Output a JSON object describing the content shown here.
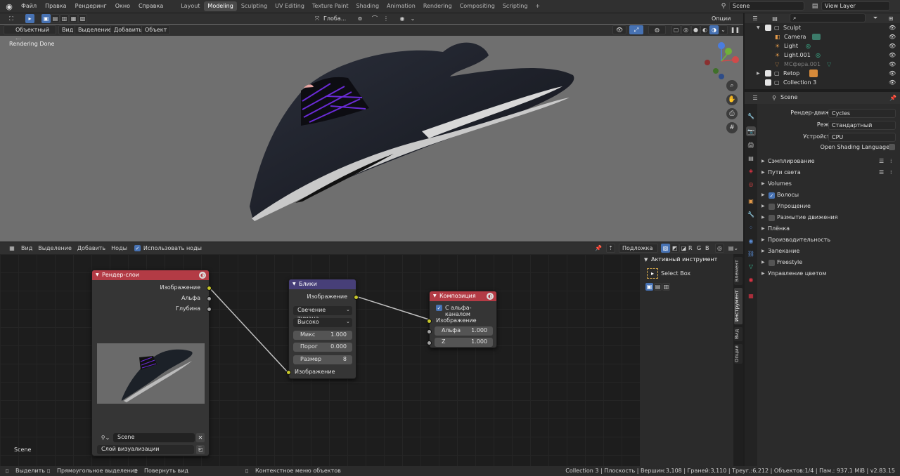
{
  "topbar": {
    "menus": [
      "Файл",
      "Правка",
      "Рендеринг",
      "Окно",
      "Справка"
    ],
    "workspaces": [
      "Layout",
      "Modeling",
      "Sculpting",
      "UV Editing",
      "Texture Paint",
      "Shading",
      "Animation",
      "Rendering",
      "Compositing",
      "Scripting"
    ],
    "active_workspace": "Modeling",
    "scene": "Scene",
    "view_layer": "View Layer",
    "add_tab": "+"
  },
  "viewport": {
    "mode": "Объектный ...",
    "menus": [
      "Вид",
      "Выделение",
      "Добавить",
      "Объект"
    ],
    "orientation": "Глоба...",
    "options": "Опции",
    "status_text": "Rendering Done"
  },
  "node_editor": {
    "menus": [
      "Вид",
      "Выделение",
      "Добавить",
      "Ноды"
    ],
    "use_nodes_label": "Использовать ноды",
    "backdrop_label": "Подложка",
    "channels": [
      "R",
      "G",
      "B"
    ],
    "scene_label": "Scene",
    "render_layers": {
      "title": "Рендер-слои",
      "outputs": [
        "Изображение",
        "Альфа",
        "Глубина"
      ],
      "scene_field": "Scene",
      "layer_field": "Слой визуализации"
    },
    "glare": {
      "title": "Блики",
      "output": "Изображение",
      "type": "Свечение тумана",
      "quality": "Высоко",
      "mix_label": "Микс",
      "mix_value": "1.000",
      "threshold_label": "Порог",
      "threshold_value": "0.000",
      "size_label": "Размер",
      "size_value": "8",
      "input": "Изображение"
    },
    "composite": {
      "title": "Композиция",
      "use_alpha": "С альфа-каналом",
      "image": "Изображение",
      "alpha_label": "Альфа",
      "alpha_value": "1.000",
      "z_label": "Z",
      "z_value": "1.000"
    }
  },
  "npanel": {
    "header": "Активный инструмент",
    "tool": "Select Box",
    "tabs": [
      "Элемент",
      "Инструмент",
      "Вид",
      "Опции"
    ],
    "active_tab": "Инструмент"
  },
  "outliner": {
    "items": [
      {
        "name": "Sculpt",
        "indent": 0,
        "dim": false
      },
      {
        "name": "Camera",
        "indent": 1,
        "dim": false
      },
      {
        "name": "Light",
        "indent": 1,
        "dim": false
      },
      {
        "name": "Light.001",
        "indent": 1,
        "dim": false
      },
      {
        "name": "МСфера.001",
        "indent": 1,
        "dim": true
      },
      {
        "name": "Retop",
        "indent": 0,
        "dim": false
      },
      {
        "name": "Collection 3",
        "indent": 0,
        "dim": false
      }
    ]
  },
  "properties": {
    "context": "Scene",
    "engine_label": "Рендер-движок",
    "engine_value": "Cycles",
    "mode_label": "Режим",
    "mode_value": "Стандартный",
    "device_label": "Устройство",
    "device_value": "CPU",
    "osl_label": "Open Shading Language",
    "panels": [
      {
        "label": "Сэмплирование",
        "checkbox": null
      },
      {
        "label": "Пути света",
        "checkbox": null
      },
      {
        "label": "Volumes",
        "checkbox": null
      },
      {
        "label": "Волосы",
        "checkbox": true
      },
      {
        "label": "Упрощение",
        "checkbox": false
      },
      {
        "label": "Размытие движения",
        "checkbox": false
      },
      {
        "label": "Плёнка",
        "checkbox": null
      },
      {
        "label": "Производительность",
        "checkbox": null
      },
      {
        "label": "Запекание",
        "checkbox": null
      },
      {
        "label": "Freestyle",
        "checkbox": false
      },
      {
        "label": "Управление цветом",
        "checkbox": null
      }
    ]
  },
  "status": {
    "select": "Выделить",
    "box": "Прямоугольное выделение",
    "rotate": "Повернуть вид",
    "context_menu": "Контекстное меню объектов",
    "stats": "Collection 3 | Плоскость | Вершин:3,108 | Граней:3,110 | Треуг.:6,212 | Объектов:1/4 | Пам.: 937.1 MiB | v2.83.15"
  }
}
